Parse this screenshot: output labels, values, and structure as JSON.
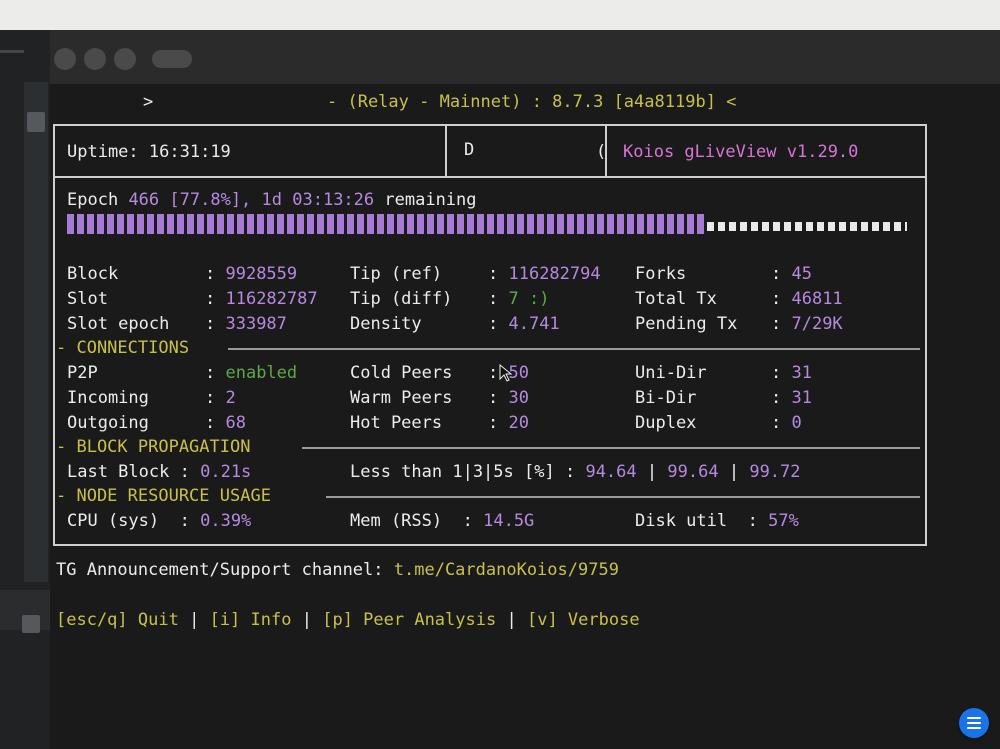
{
  "header": {
    "prompt_glyph": ">",
    "title": "- (Relay - Mainnet) : 8.7.3 [a4a8119b] <"
  },
  "top_row": {
    "uptime_label": "Uptime:",
    "uptime_value": "16:31:19",
    "middle_glyph": "D",
    "middle_glyph_right": "(",
    "app_name": "Koios gLiveView v1.29.0"
  },
  "epoch": {
    "label": "Epoch",
    "number": "466",
    "percent": "[77.8%],",
    "remaining_time": "1d 03:13:26",
    "remaining_label": "remaining",
    "progress": 0.778
  },
  "stats": [
    {
      "c1_label": "Block",
      "c1_value": "9928559",
      "c2_label": "Tip (ref)",
      "c2_value": "116282794",
      "c3_label": "Forks",
      "c3_value": "45"
    },
    {
      "c1_label": "Slot",
      "c1_value": "116282787",
      "c2_label": "Tip (diff)",
      "c2_value": "7 :)",
      "c3_label": "Total Tx",
      "c3_value": "46811"
    },
    {
      "c1_label": "Slot epoch",
      "c1_value": "333987",
      "c2_label": "Density",
      "c2_value": "4.741",
      "c3_label": "Pending Tx",
      "c3_value": "7/29K"
    }
  ],
  "connections": {
    "title": "- CONNECTIONS",
    "rows": [
      {
        "c1_label": "P2P",
        "c1_value": "enabled",
        "c2_label": "Cold Peers",
        "c2_value": "50",
        "c3_label": "Uni-Dir",
        "c3_value": "31"
      },
      {
        "c1_label": "Incoming",
        "c1_value": "2",
        "c2_label": "Warm Peers",
        "c2_value": "30",
        "c3_label": "Bi-Dir",
        "c3_value": "31"
      },
      {
        "c1_label": "Outgoing",
        "c1_value": "68",
        "c2_label": "Hot Peers",
        "c2_value": "20",
        "c3_label": "Duplex",
        "c3_value": "0"
      }
    ]
  },
  "block_propagation": {
    "title": "- BLOCK PROPAGATION",
    "last_block_label": "Last Block",
    "last_block_value": "0.21s",
    "less_than_label": "Less than 1|3|5s [%]",
    "v1": "94.64",
    "v2": "99.64",
    "v3": "99.72"
  },
  "resources": {
    "title": "- NODE RESOURCE USAGE",
    "cpu_label": "CPU (sys)",
    "cpu_value": "0.39%",
    "mem_label": "Mem (RSS)",
    "mem_value": "14.5G",
    "disk_label": "Disk util",
    "disk_value": "57%"
  },
  "footer": {
    "channel_label": "TG Announcement/Support channel:",
    "channel_link": "t.me/CardanoKoios/9759",
    "key_quit": "[esc/q] Quit",
    "key_info": "[i] Info",
    "key_peer": "[p] Peer Analysis",
    "key_verbose": "[v] Verbose",
    "separator": "|"
  },
  "colors": {
    "value_purple": "#b589e0",
    "key_yellow": "#c8c04a",
    "enabled_green": "#5fa84a",
    "terminal_bg": "#1a1a1a"
  },
  "icons": [
    "mouse-cursor-icon",
    "menu-icon"
  ]
}
